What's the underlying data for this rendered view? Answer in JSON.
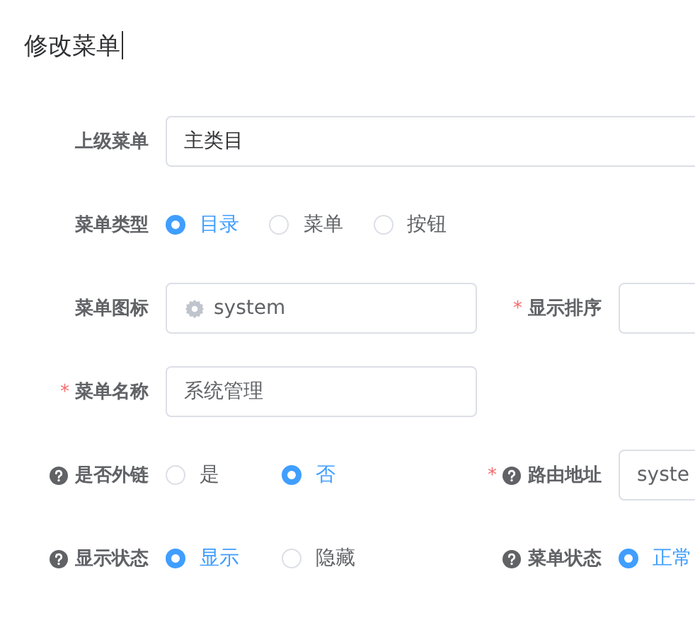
{
  "title": "修改菜单",
  "rows": [
    {
      "fields": [
        {
          "kind": "wide_input",
          "label": "上级菜单",
          "value": "主类目"
        }
      ]
    },
    {
      "fields": [
        {
          "kind": "radio",
          "label": "菜单类型",
          "options": [
            {
              "label": "目录",
              "selected": true
            },
            {
              "label": "菜单",
              "selected": false
            },
            {
              "label": "按钮",
              "selected": false
            }
          ]
        }
      ]
    },
    {
      "fields": [
        {
          "kind": "icon_input",
          "label": "菜单图标",
          "value": "system"
        },
        {
          "kind": "input",
          "required_mark": "*",
          "label": "显示排序"
        }
      ]
    },
    {
      "fields": [
        {
          "kind": "input",
          "required_mark": "*",
          "label": "菜单名称",
          "value": "系统管理"
        }
      ]
    },
    {
      "fields": [
        {
          "kind": "radio",
          "label": "是否外链",
          "help": true,
          "options": [
            {
              "label": "是",
              "selected": false
            },
            {
              "label": "否",
              "selected": true
            }
          ]
        },
        {
          "kind": "input",
          "required_mark": "*",
          "label": "路由地址",
          "help": true,
          "value": "syste"
        }
      ]
    },
    {
      "fields": [
        {
          "kind": "radio",
          "label": "显示状态",
          "help": true,
          "options": [
            {
              "label": "显示",
              "selected": true
            },
            {
              "label": "隐藏",
              "selected": false
            }
          ]
        },
        {
          "kind": "radio",
          "label": "菜单状态",
          "help": true,
          "options": [
            {
              "label": "正常",
              "selected": true
            }
          ]
        }
      ]
    }
  ]
}
